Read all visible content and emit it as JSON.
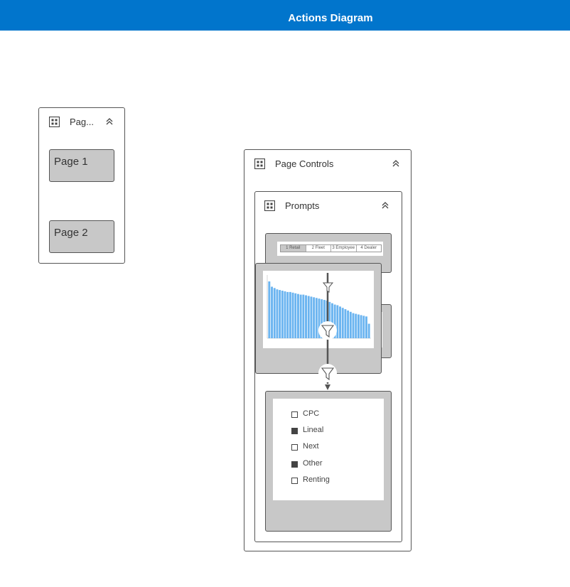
{
  "header": {
    "title": "Actions Diagram"
  },
  "pages_panel": {
    "title": "Pag...",
    "pages": [
      {
        "label": "Page 1"
      },
      {
        "label": "Page 2"
      }
    ]
  },
  "page_controls": {
    "title": "Page Controls",
    "prompts": {
      "title": "Prompts",
      "tabs": [
        {
          "label": "1 Retail",
          "selected": true
        },
        {
          "label": "2 Fleet",
          "selected": false
        },
        {
          "label": "3 Employee",
          "selected": false
        },
        {
          "label": "4 Dealer",
          "selected": false
        }
      ]
    },
    "legend_items": [
      {
        "label": "CPC",
        "checked": false
      },
      {
        "label": "Lineal",
        "checked": true
      },
      {
        "label": "Next",
        "checked": false
      },
      {
        "label": "Other",
        "checked": true
      },
      {
        "label": "Renting",
        "checked": false
      }
    ]
  },
  "colors": {
    "header": "#0175CC",
    "bar": "#6AB4F0",
    "card": "#C8C8C8"
  },
  "chart_data": {
    "type": "bar",
    "values": [
      86,
      78,
      76,
      74,
      73,
      72,
      71,
      70,
      70,
      69,
      68,
      67,
      66,
      66,
      65,
      64,
      63,
      62,
      61,
      60,
      59,
      58,
      57,
      55,
      53,
      51,
      50,
      48,
      46,
      44,
      42,
      40,
      38,
      37,
      36,
      35,
      34,
      33,
      22
    ]
  }
}
